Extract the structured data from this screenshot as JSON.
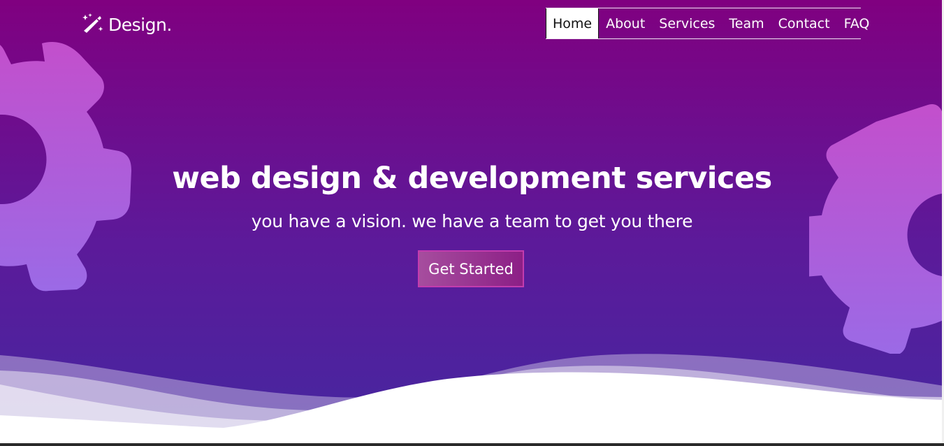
{
  "brand": {
    "name": "Design.",
    "icon": "magic-wand-icon"
  },
  "nav": {
    "items": [
      {
        "label": "Home",
        "active": true
      },
      {
        "label": "About",
        "active": false
      },
      {
        "label": "Services",
        "active": false
      },
      {
        "label": "Team",
        "active": false
      },
      {
        "label": "Contact",
        "active": false
      },
      {
        "label": "FAQ",
        "active": false
      }
    ]
  },
  "hero": {
    "title": "web design & development services",
    "subtitle": "you have a vision. we have a team to get you there",
    "cta_label": "Get Started"
  },
  "decor": {
    "left_icon": "gear-icon",
    "right_icon": "gear-icon"
  },
  "colors": {
    "gradient_top": "#800080",
    "gradient_bottom": "#4527a0",
    "gear_top": "#c34fcc",
    "gear_bottom": "#9b6ae6",
    "cta_border": "#c33cae",
    "wave": "#ffffff"
  }
}
